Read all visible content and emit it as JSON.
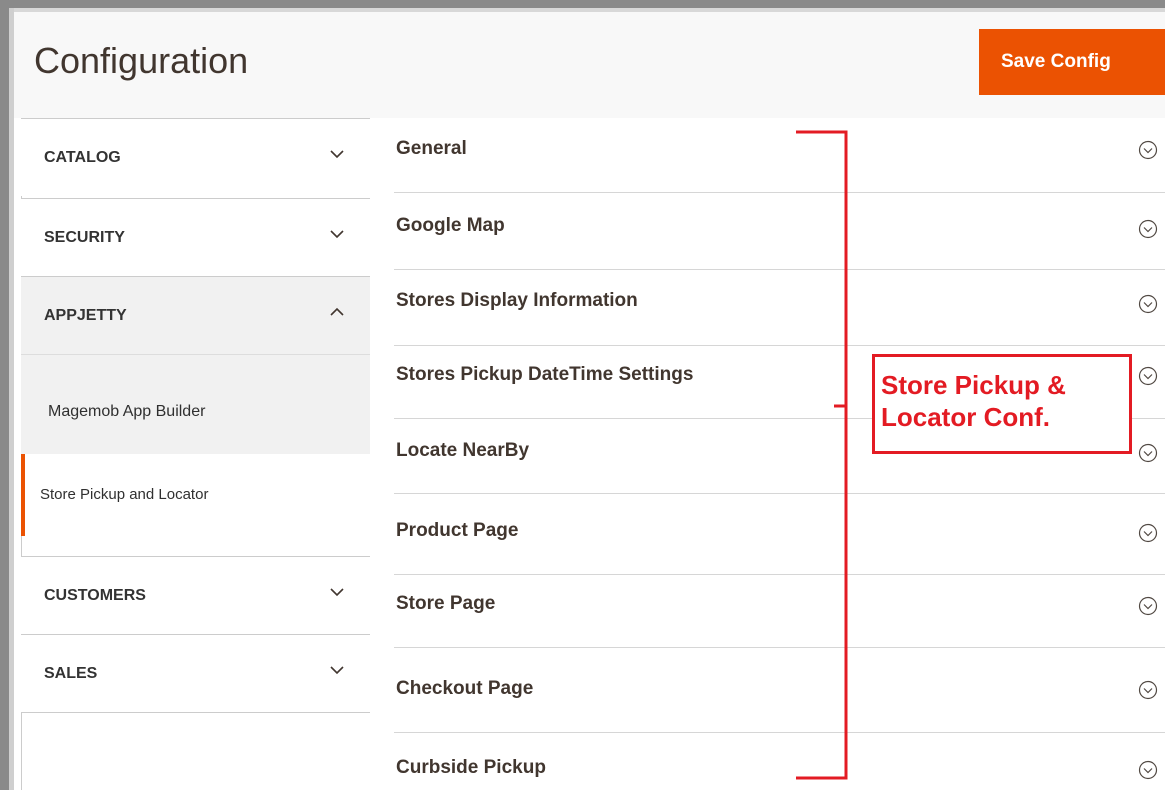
{
  "header": {
    "title": "Configuration",
    "save_label": "Save Config"
  },
  "sidebar": {
    "tabs": [
      {
        "label": "CATALOG",
        "state": "collapsed"
      },
      {
        "label": "SECURITY",
        "state": "collapsed"
      },
      {
        "label": "APPJETTY",
        "state": "expanded"
      },
      {
        "label": "CUSTOMERS",
        "state": "collapsed"
      },
      {
        "label": "SALES",
        "state": "collapsed"
      }
    ],
    "appjetty_items": [
      {
        "label": "Magemob App Builder",
        "active": false
      },
      {
        "label": "Store Pickup and Locator",
        "active": true
      }
    ]
  },
  "sections": [
    {
      "label": "General"
    },
    {
      "label": "Google Map"
    },
    {
      "label": "Stores Display Information"
    },
    {
      "label": "Stores Pickup DateTime Settings"
    },
    {
      "label": "Locate NearBy"
    },
    {
      "label": "Product Page"
    },
    {
      "label": "Store Page"
    },
    {
      "label": "Checkout Page"
    },
    {
      "label": "Curbside Pickup"
    }
  ],
  "annotation": {
    "line1": "Store Pickup &",
    "line2": "Locator Conf.",
    "color": "#e31b23"
  },
  "colors": {
    "accent": "#eb5202",
    "annotation": "#e31b23"
  },
  "icons": {
    "tab_chevron": "chevron-down-icon",
    "tab_chevron_open": "chevron-up-icon",
    "section_toggle": "circle-chevron-down-icon"
  }
}
